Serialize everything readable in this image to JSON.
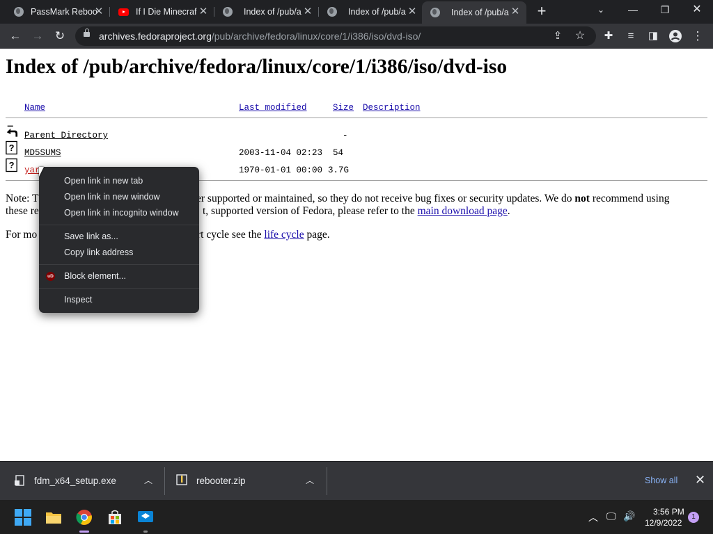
{
  "browser": {
    "tabs": [
      {
        "title": "PassMark Reboo",
        "icon": "globe-icon"
      },
      {
        "title": "If I Die Minecraf",
        "icon": "youtube-icon"
      },
      {
        "title": "Index of /pub/a",
        "icon": "globe-icon"
      },
      {
        "title": "Index of /pub/a",
        "icon": "globe-icon"
      },
      {
        "title": "Index of /pub/a",
        "icon": "globe-icon"
      }
    ],
    "url_domain": "archives.fedoraproject.org",
    "url_path": "/pub/archive/fedora/linux/core/1/i386/iso/dvd-iso/"
  },
  "page": {
    "heading": "Index of /pub/archive/fedora/linux/core/1/i386/iso/dvd-iso",
    "columns": {
      "name": "Name",
      "modified": "Last modified",
      "size": "Size",
      "description": "Description"
    },
    "rows": [
      {
        "name": "Parent Directory",
        "modified": "",
        "size": "-",
        "icon": "back-arrow-icon"
      },
      {
        "name": "MD5SUMS",
        "modified": "2003-11-04 02:23",
        "size": "54",
        "icon": "unknown-file-icon"
      },
      {
        "name": "yar",
        "modified": "1970-01-01 00:00",
        "size": "3.7G",
        "icon": "unknown-file-icon"
      }
    ],
    "note_line1_a": "Note: T",
    "note_line1_b": "er supported or maintained, so they do not receive bug fixes or security updates. We do ",
    "note_line1_bold": "not",
    "note_line1_c": " recommend using",
    "note_line2_a": "these re",
    "note_line2_b": "t, supported version of Fedora, please refer to the ",
    "note_line2_link": "main download page",
    "note_line2_c": ".",
    "lifecycle_a": "For mo",
    "lifecycle_b": "rt cycle see the ",
    "lifecycle_link": "life cycle",
    "lifecycle_c": " page."
  },
  "context_menu": {
    "items": [
      "Open link in new tab",
      "Open link in new window",
      "Open link in incognito window",
      "Save link as...",
      "Copy link address",
      "Block element...",
      "Inspect"
    ],
    "ublock_badge": "uD"
  },
  "downloads": {
    "items": [
      {
        "name": "fdm_x64_setup.exe"
      },
      {
        "name": "rebooter.zip"
      }
    ],
    "show_all": "Show all"
  },
  "taskbar": {
    "time": "3:56 PM",
    "date": "12/9/2022",
    "notification_count": "1"
  },
  "colors": {
    "link": "#1a0dab",
    "visited_link": "#c5221f",
    "chrome_dark": "#202124",
    "toolbar": "#35363a"
  }
}
